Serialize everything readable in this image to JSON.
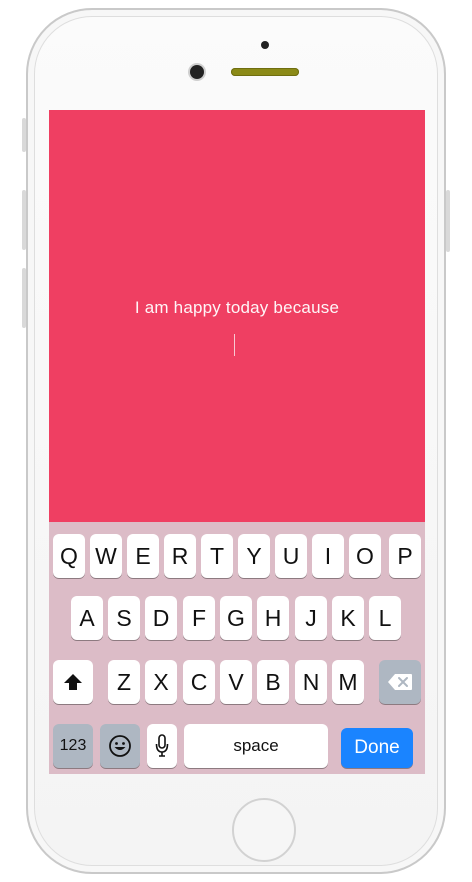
{
  "screen": {
    "background": "#ef3f62",
    "prompt": "I am happy today because"
  },
  "keyboard": {
    "row1": [
      "Q",
      "W",
      "E",
      "R",
      "T",
      "Y",
      "U",
      "I",
      "O",
      "P"
    ],
    "row2": [
      "A",
      "S",
      "D",
      "F",
      "G",
      "H",
      "J",
      "K",
      "L"
    ],
    "row3": [
      "Z",
      "X",
      "C",
      "V",
      "B",
      "N",
      "M"
    ],
    "numbers_label": "123",
    "space_label": "space",
    "done_label": "Done",
    "done_color": "#1a84ff",
    "shift_icon": "shift-icon",
    "delete_icon": "backspace-icon",
    "emoji_icon": "emoji-icon",
    "mic_icon": "microphone-icon"
  }
}
